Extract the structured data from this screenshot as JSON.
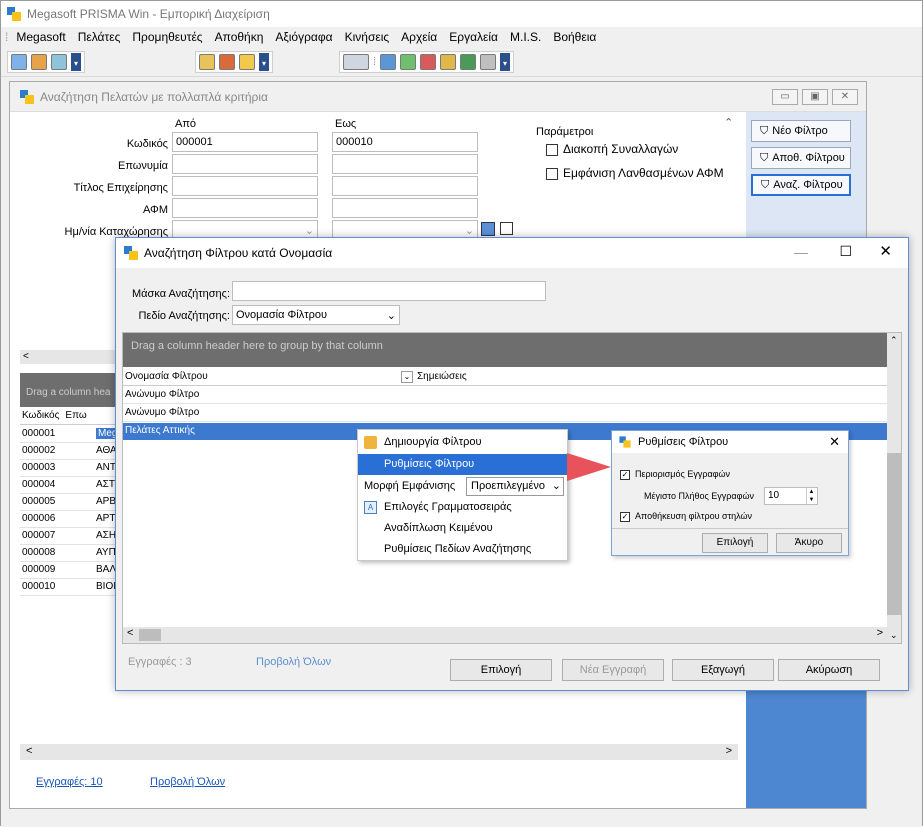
{
  "app": {
    "title": "Megasoft PRISMA Win - Εμπορική Διαχείριση",
    "menu": [
      "Megasoft",
      "Πελάτες",
      "Προμηθευτές",
      "Αποθήκη",
      "Αξιόγραφα",
      "Κινήσεις",
      "Αρχεία",
      "Εργαλεία",
      "M.I.S.",
      "Βοήθεια"
    ]
  },
  "search_window": {
    "title": "Αναζήτηση Πελατών με πολλαπλά κριτήρια",
    "from_label": "Από",
    "to_label": "Εως",
    "fields": {
      "code": "Κωδικός",
      "name": "Επωνυμία",
      "business_title": "Τίτλος Επιχείρησης",
      "afm": "ΑΦΜ",
      "reg_date": "Ημ/νία Καταχώρησης"
    },
    "code_from": "000001",
    "code_to": "000010",
    "params_label": "Παράμετροι",
    "check_stop": "Διακοπή Συναλλαγών",
    "check_afm": "Εμφάνιση Λανθασμένων ΑΦΜ",
    "btn_new_filter": "Νέο Φίλτρο",
    "btn_save_filter": "Αποθ. Φίλτρου",
    "btn_search_filter": "Αναζ. Φίλτρου",
    "group_hint": "Drag a column hea",
    "col_code": "Κωδικός",
    "col_name": "Επω",
    "rows": [
      {
        "code": "000001",
        "name": "Meg"
      },
      {
        "code": "000002",
        "name": "ΑΘΑ"
      },
      {
        "code": "000003",
        "name": "ΑΝΤ"
      },
      {
        "code": "000004",
        "name": "ΑΣΤ"
      },
      {
        "code": "000005",
        "name": "ΑΡΒ"
      },
      {
        "code": "000006",
        "name": "ΑΡΤ"
      },
      {
        "code": "000007",
        "name": "ΑΣΗ"
      },
      {
        "code": "000008",
        "name": "ΑΥΠ"
      },
      {
        "code": "000009",
        "name": "ΒΑΛ"
      },
      {
        "code": "000010",
        "name": "ΒΙΟΙ"
      }
    ],
    "records": "Εγγραφές: 10",
    "view_all": "Προβολή Όλων"
  },
  "filter_dialog": {
    "title": "Αναζήτηση Φίλτρου κατά Ονομασία",
    "mask_label": "Μάσκα Αναζήτησης:",
    "mask_value": "",
    "field_label": "Πεδίο Αναζήτησης:",
    "field_value": "Ονομασία Φίλτρου",
    "group_hint": "Drag a column header here to group by that column",
    "col_name": "Ονομασία Φίλτρου",
    "col_notes": "Σημειώσεις",
    "rows": [
      "Ανώνυμο Φίλτρο",
      "Ανώνυμο Φίλτρο",
      "Πελάτες Αττικής"
    ],
    "records": "Εγγραφές : 3",
    "view_all": "Προβολή Όλων",
    "btn_select": "Επιλογή",
    "btn_new": "Νέα Εγγραφή",
    "btn_export": "Εξαγωγή",
    "btn_cancel": "Ακύρωση"
  },
  "context_menu": {
    "create": "Δημιουργία Φίλτρου",
    "settings": "Ρυθμίσεις Φίλτρου",
    "format_label": "Μορφή Εμφάνισης",
    "format_value": "Προεπιλεγμένο",
    "font": "Επιλογές Γραμματοσειράς",
    "wrap": "Αναδίπλωση Κειμένου",
    "search_fields": "Ρυθμίσεις Πεδίων Αναζήτησης"
  },
  "settings_dialog": {
    "title": "Ρυθμίσεις Φίλτρου",
    "limit_records": "Περιορισμός Εγγραφών",
    "max_records_label": "Μέγιστο Πλήθος Εγγραφών",
    "max_records_value": "10",
    "save_columns": "Αποθήκευση φίλτρου στηλών",
    "btn_select": "Επιλογή",
    "btn_cancel": "Άκυρο"
  },
  "colors": {
    "accent": "#2a6fd6",
    "selection": "#3d79cf",
    "arrow": "#e8525b"
  }
}
